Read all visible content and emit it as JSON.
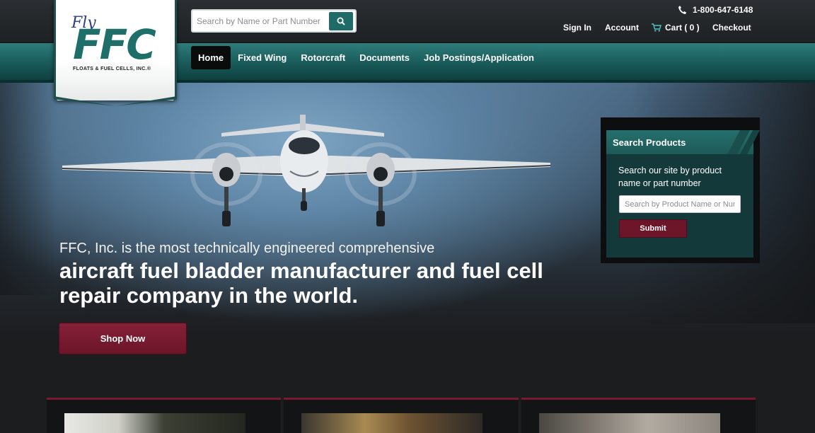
{
  "logo": {
    "fly": "Fly",
    "ffc": "FFC",
    "tagline": "FLOATS & FUEL CELLS, INC.®"
  },
  "header": {
    "search_placeholder": "Search by Name or Part Number",
    "search_icon": "search-icon",
    "phone": "1-800-647-6148",
    "links": {
      "sign_in": "Sign In",
      "account": "Account",
      "cart": "Cart ( 0 )",
      "checkout": "Checkout"
    }
  },
  "nav": [
    {
      "label": "Home",
      "active": true
    },
    {
      "label": "Fixed Wing"
    },
    {
      "label": "Rotorcraft"
    },
    {
      "label": "Documents"
    },
    {
      "label": "Job Postings/Application"
    }
  ],
  "hero": {
    "line1": "FFC, Inc. is the most technically engineered comprehensive",
    "line2": "aircraft fuel bladder manufacturer and fuel cell repair company in the world.",
    "cta": "Shop Now"
  },
  "search_products": {
    "title": "Search Products",
    "description": "Search our site by product name or part number",
    "placeholder": "Search by Product Name or Number",
    "submit": "Submit"
  },
  "colors": {
    "teal": "#1f6b67",
    "maroon": "#6e1629",
    "dark": "#1c1d1f"
  }
}
